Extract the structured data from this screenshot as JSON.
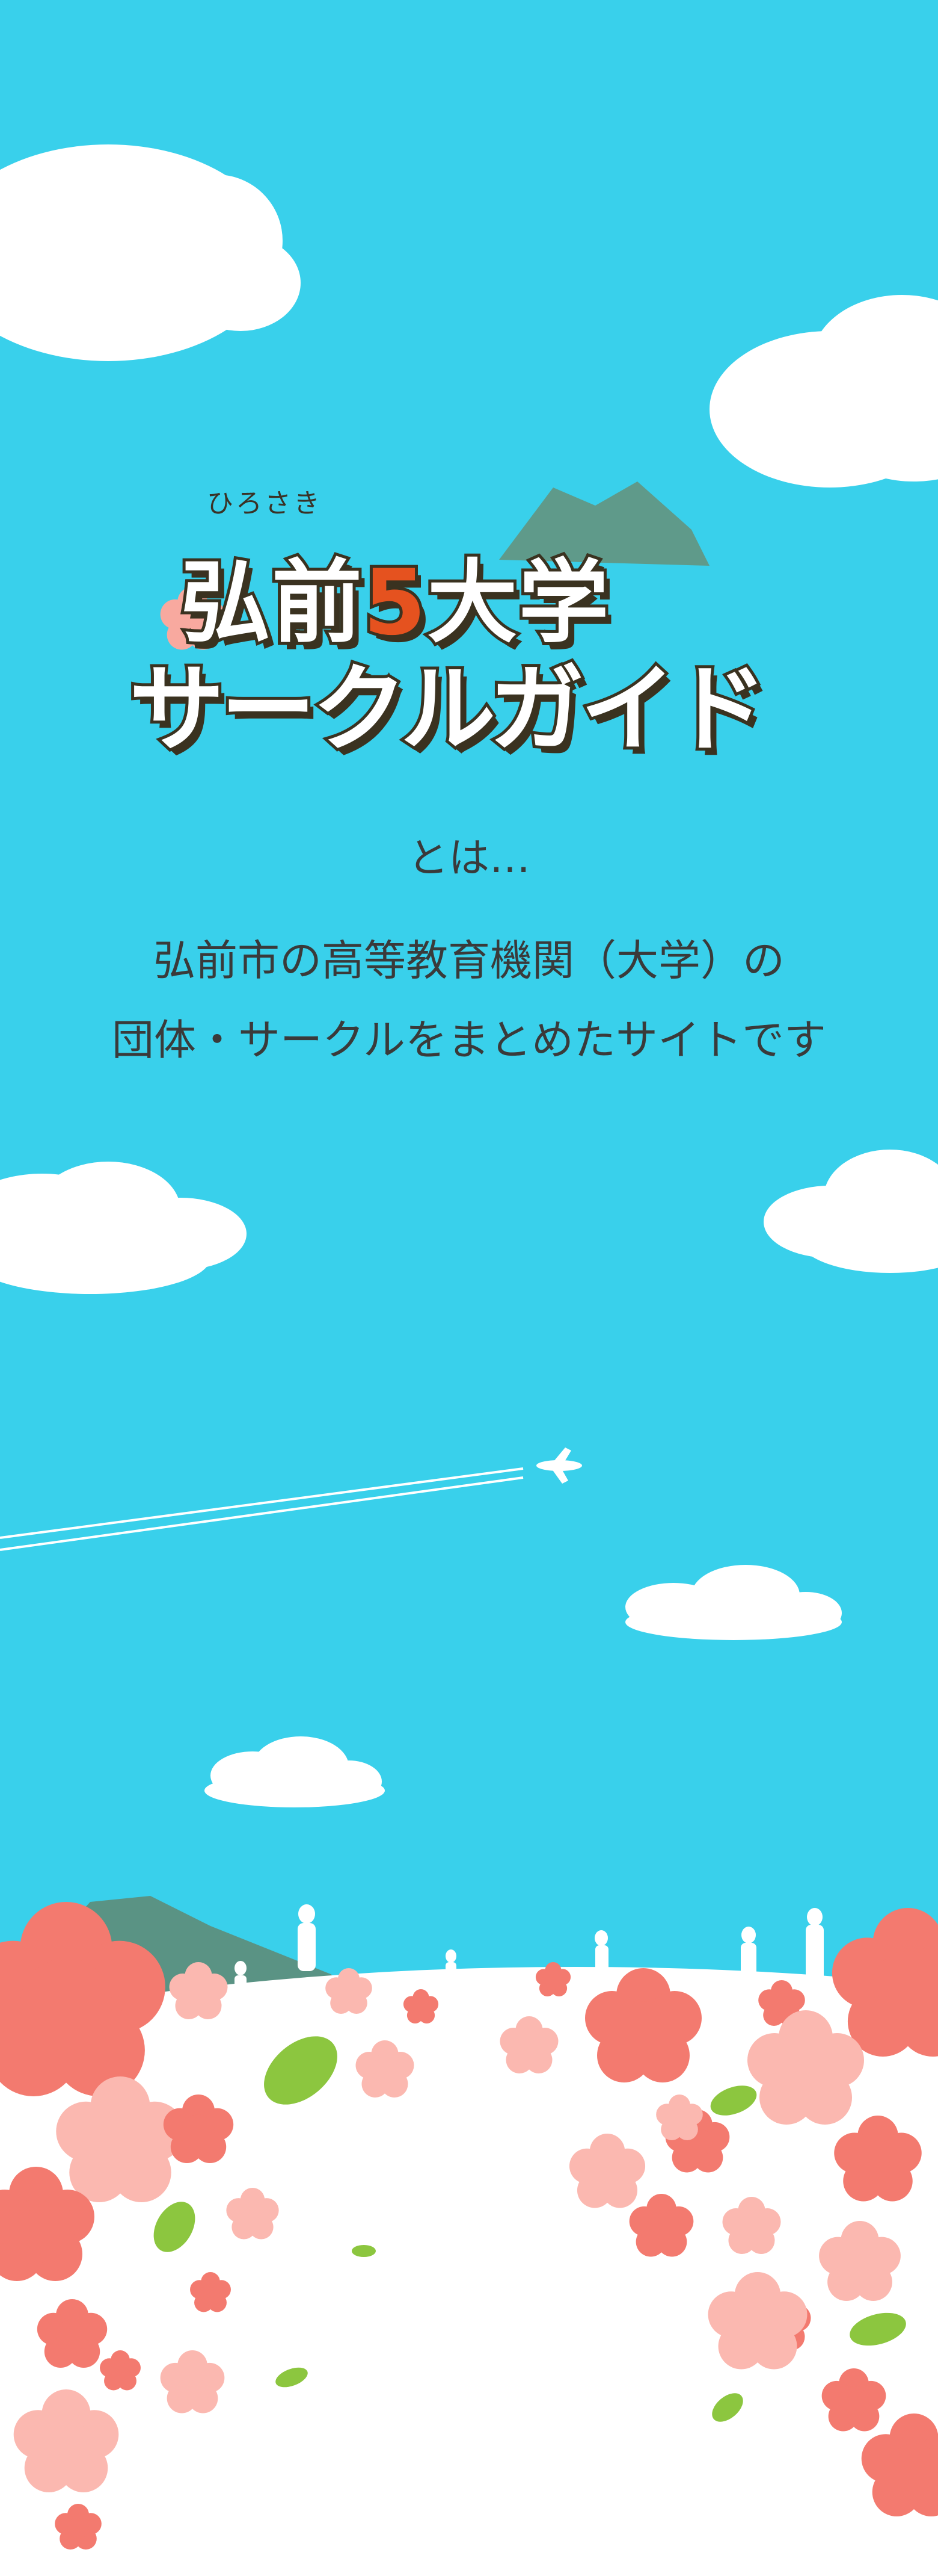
{
  "logo": {
    "small": "ひろさき",
    "line1_a": "弘前",
    "line1_num": "5",
    "line1_b": "大学",
    "line2": "サークルガイド"
  },
  "intro": {
    "line1": "とは…",
    "line2": "弘前市の高等教育機関（大学）の",
    "line3": "団体・サークルをまとめたサイトです"
  },
  "colors": {
    "sky": "#39d0eb",
    "cloud": "#ffffff",
    "mountain": "#5a9a8a",
    "blossom_dark": "#f37a6f",
    "blossom_light": "#fbb8b0",
    "leaf": "#8cc63f",
    "text": "#3a3a3a"
  }
}
